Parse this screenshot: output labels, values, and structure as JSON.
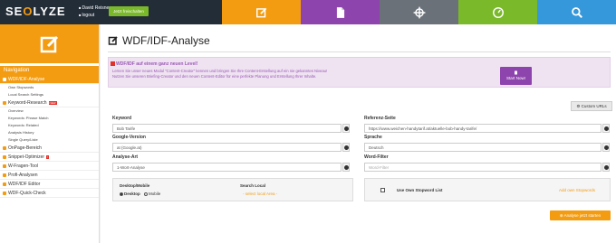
{
  "topbar": {
    "logo_pre": "SE",
    "logo_o": "O",
    "logo_post": "LYZE",
    "user_name": "David Reisner",
    "logout": "logout",
    "unlock_label": "Jetzt freischalten",
    "nav_colors": [
      "#f39c12",
      "#8e44ad",
      "#6b7179",
      "#7ab929",
      "#3498db"
    ],
    "nav_icons": [
      "edit-icon",
      "document-icon",
      "crosshair-icon",
      "gauge-icon",
      "search-icon"
    ]
  },
  "sidebar": {
    "heading": "Navigation",
    "items": [
      {
        "label": "WDF/IDF-Analyse",
        "type": "main",
        "active": true
      },
      {
        "label": "Own Stopwords",
        "type": "sub"
      },
      {
        "label": "Local Search Settings",
        "type": "sub"
      },
      {
        "label": "Keyword-Research",
        "type": "main",
        "badge": "NEW"
      },
      {
        "label": "Overview",
        "type": "sub"
      },
      {
        "label": "Keywords: Phrase Match",
        "type": "sub"
      },
      {
        "label": "Keywords: Related",
        "type": "sub"
      },
      {
        "label": "Analysis History",
        "type": "sub"
      },
      {
        "label": "Single Query/Liste",
        "type": "sub"
      },
      {
        "label": "OnPage-Bereich",
        "type": "main"
      },
      {
        "label": "Snippet-Optimizer",
        "type": "main",
        "badge": "!"
      },
      {
        "label": "W-Fragen-Tool",
        "type": "main"
      },
      {
        "label": "Profi-Analysen",
        "type": "main"
      },
      {
        "label": "WDF/IDF Editor",
        "type": "main"
      },
      {
        "label": "WDF-Quick-Check",
        "type": "main"
      }
    ]
  },
  "main": {
    "title": "WDF/IDF-Analyse",
    "banner": {
      "title": "WDF/IDF auf einem ganz neuen Level!",
      "line1": "Lernen Sie unser neues Modul \"Content-Creator\" kennen und bringen Sie Ihre Content-Erstellung auf ein nie gekanntes Niveau!",
      "line2": "Nutzen Sie unseren Briefing-Creator und den neuen Content-Editor für eine perfekte Planung und Erstellung Ihrer Inhalte.",
      "button": "Start Now!"
    },
    "custom_urls": "Custom URLs",
    "keyword_label": "Keyword",
    "keyword_value": "Bob Tarife",
    "google_label": "Google-Version",
    "google_value": "at (Google.at)",
    "analyse_label": "Analyse-Art",
    "analyse_value": "1-Wort-Analyse",
    "ref_label": "Referenz-Seite",
    "ref_value": "https://www.weichen-handytarif.at/aktuelle-bob-handy-tarife/",
    "lang_label": "Sprache",
    "lang_value": "Deutsch",
    "filter_label": "Word-Filter",
    "filter_placeholder": "Word-Filter",
    "device_label": "Desktop/Mobile",
    "desktop": "Desktop",
    "mobile": "Mobile",
    "search_local_label": "Search Local",
    "search_local_value": "- select local Area -",
    "stopword_label": "Use Own Stopword List",
    "add_stopwords": "Add own Stopwords",
    "analyze_button": "Analyse jetzt starten"
  }
}
